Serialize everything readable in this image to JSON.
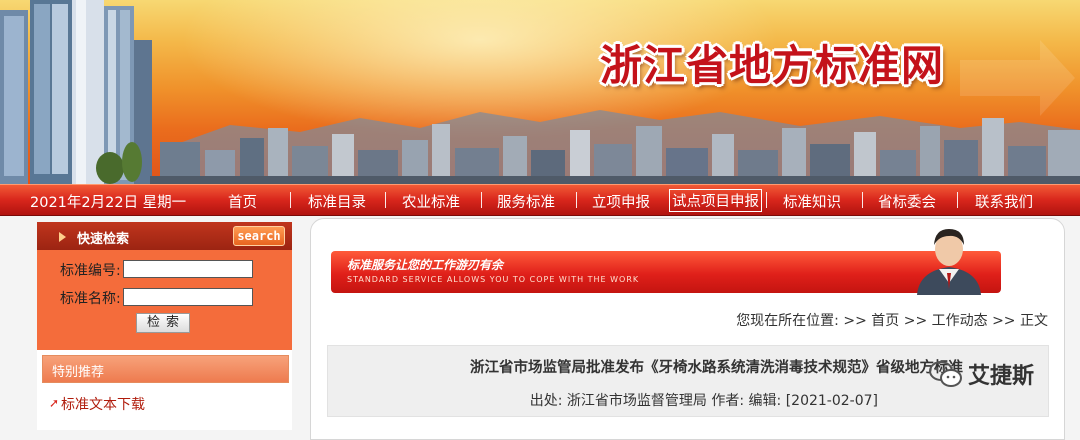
{
  "site": {
    "title": "浙江省地方标准网"
  },
  "nav": {
    "date": "2021年2月22日  星期一",
    "items": [
      "首页",
      "标准目录",
      "农业标准",
      "服务标准",
      "立项申报",
      "试点项目申报",
      "标准知识",
      "省标委会",
      "联系我们"
    ],
    "active_index": 5
  },
  "quick_search": {
    "title": "快速检索",
    "tag": "search",
    "label_code": "标准编号:",
    "label_name": "标准名称:",
    "code_value": "",
    "name_value": "",
    "button": "检索"
  },
  "recommend": {
    "title": "特别推荐",
    "link": "标准文本下载"
  },
  "slogan": {
    "cn": "标准服务让您的工作游刃有余",
    "en": "STANDARD SERVICE ALLOWS YOU TO COPE WITH THE WORK"
  },
  "breadcrumb": "您现在所在位置: >> 首页 >> 工作动态 >> 正文",
  "article": {
    "title": "浙江省市场监管局批准发布《牙椅水路系统清洗消毒技术规范》省级地方标准",
    "meta": "出处: 浙江省市场监督管理局 作者:   编辑:   [2021-02-07]"
  },
  "watermark": "艾捷斯",
  "colors": {
    "nav_red": "#d8261c",
    "banner_orange": "#f0922b",
    "title_red": "#c4121a"
  }
}
